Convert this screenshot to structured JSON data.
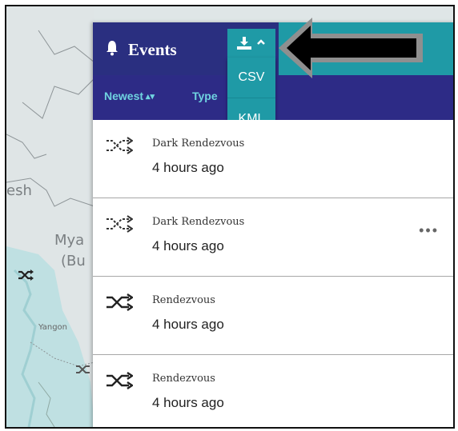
{
  "map": {
    "labels": [
      "esh",
      "Mya",
      "(Bu",
      "Yangon"
    ]
  },
  "panel": {
    "title": "Events",
    "sort_label": "Newest",
    "sort_arrows": "▴▾",
    "type_label": "Type",
    "download_menu": {
      "items": [
        "CSV",
        "KML"
      ]
    },
    "events": [
      {
        "name": "Dark Rendezvous",
        "time": "4 hours ago"
      },
      {
        "name": "Dark Rendezvous",
        "time": "4 hours ago",
        "more": "•••"
      },
      {
        "name": "Rendezvous",
        "time": "4 hours ago"
      },
      {
        "name": "Rendezvous",
        "time": "4 hours ago"
      }
    ]
  },
  "colors": {
    "header_navy": "#2a2f80",
    "header_teal": "#1f9aa6",
    "link_cyan": "#6fd3e0"
  },
  "icons": {
    "header": "bell-icon",
    "download": "download-icon",
    "caret": "chevron-up-icon",
    "event": "shuffle-icon"
  }
}
